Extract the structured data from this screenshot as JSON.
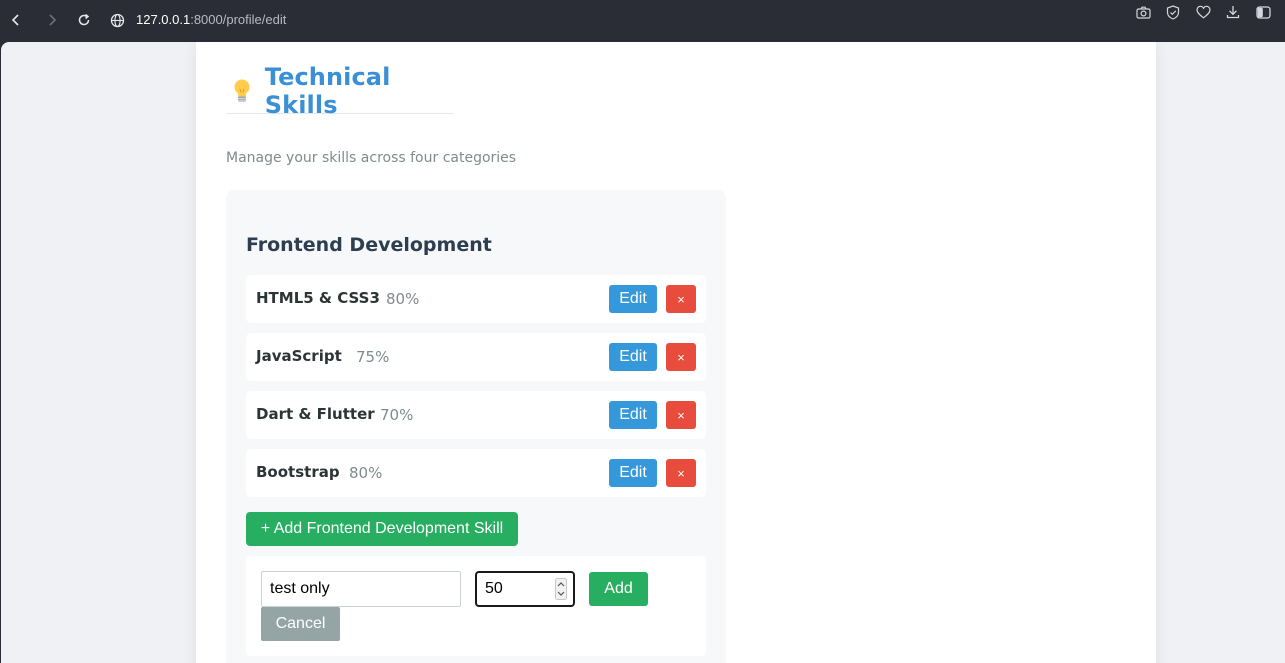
{
  "browser": {
    "url_host": "127.0.0.1",
    "url_rest": ":8000/profile/edit",
    "icons": [
      "back-icon",
      "forward-icon",
      "reload-icon",
      "globe-icon",
      "camera-icon",
      "shield-check-icon",
      "heart-icon",
      "download-icon",
      "sidebar-toggle-icon"
    ]
  },
  "section": {
    "icon": "lightbulb-icon",
    "title": "Technical Skills",
    "subtitle": "Manage your skills across four categories"
  },
  "category": {
    "title": "Frontend Development",
    "skills": [
      {
        "name": "HTML5 & CSS3",
        "percent": "80%"
      },
      {
        "name": "JavaScript",
        "percent": "75%"
      },
      {
        "name": "Dart & Flutter",
        "percent": "70%"
      },
      {
        "name": "Bootstrap",
        "percent": "80%"
      }
    ],
    "edit_label": "Edit",
    "delete_label": "×",
    "add_skill_label": "+ Add Frontend Development Skill"
  },
  "add_form": {
    "name_value": "test only",
    "percent_value": "50",
    "add_label": "Add",
    "cancel_label": "Cancel"
  },
  "colors": {
    "accent_blue": "#3498db",
    "title_blue": "#3a8fd6",
    "danger_red": "#e74c3c",
    "success_green": "#27ae60",
    "muted_gray": "#95a5a6"
  }
}
